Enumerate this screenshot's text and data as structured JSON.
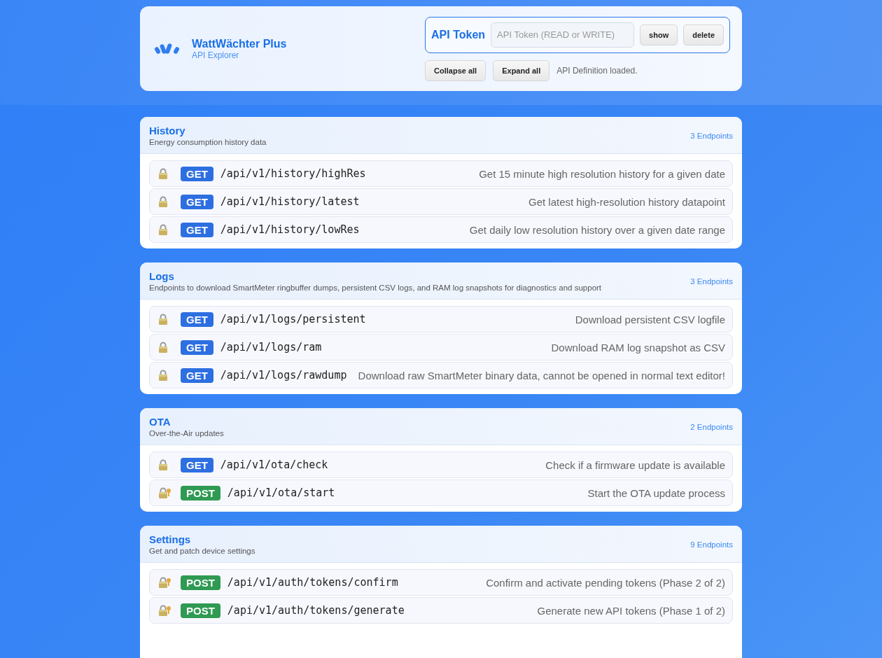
{
  "header": {
    "title": "WattWächter Plus",
    "subtitle": "API Explorer",
    "token": {
      "label": "API Token",
      "placeholder": "API Token (READ or WRITE)",
      "buttons": [
        "show",
        "delete"
      ]
    },
    "actions": [
      "Collapse all",
      "Expand all"
    ],
    "status": "API Definition loaded."
  },
  "sections": [
    {
      "title": "History",
      "description": "Energy consumption history data",
      "count": "3 Endpoints",
      "endpoints": [
        {
          "kind": "read",
          "method": "GET",
          "path": "/api/v1/history/highRes",
          "summary": "Get 15 minute high resolution history for a given date"
        },
        {
          "kind": "read",
          "method": "GET",
          "path": "/api/v1/history/latest",
          "summary": "Get latest high-resolution history datapoint"
        },
        {
          "kind": "read",
          "method": "GET",
          "path": "/api/v1/history/lowRes",
          "summary": "Get daily low resolution history over a given date range"
        }
      ]
    },
    {
      "title": "Logs",
      "description": "Endpoints to download SmartMeter ringbuffer dumps, persistent CSV logs, and RAM log snapshots for diagnostics and support",
      "count": "3 Endpoints",
      "endpoints": [
        {
          "kind": "read",
          "method": "GET",
          "path": "/api/v1/logs/persistent",
          "summary": "Download persistent CSV logfile"
        },
        {
          "kind": "read",
          "method": "GET",
          "path": "/api/v1/logs/ram",
          "summary": "Download RAM log snapshot as CSV"
        },
        {
          "kind": "read",
          "method": "GET",
          "path": "/api/v1/logs/rawdump",
          "summary": "Download raw SmartMeter binary data, cannot be opened in normal text editor!"
        }
      ]
    },
    {
      "title": "OTA",
      "description": "Over-the-Air updates",
      "count": "2 Endpoints",
      "endpoints": [
        {
          "kind": "read",
          "method": "GET",
          "path": "/api/v1/ota/check",
          "summary": "Check if a firmware update is available"
        },
        {
          "kind": "write",
          "method": "POST",
          "path": "/api/v1/ota/start",
          "summary": "Start the OTA update process"
        }
      ]
    },
    {
      "title": "Settings",
      "description": "Get and patch device settings",
      "count": "9 Endpoints",
      "endpoints": [
        {
          "kind": "write",
          "method": "POST",
          "path": "/api/v1/auth/tokens/confirm",
          "summary": "Confirm and activate pending tokens (Phase 2 of 2)"
        },
        {
          "kind": "write",
          "method": "POST",
          "path": "/api/v1/auth/tokens/generate",
          "summary": "Generate new API tokens (Phase 1 of 2)"
        }
      ]
    }
  ]
}
